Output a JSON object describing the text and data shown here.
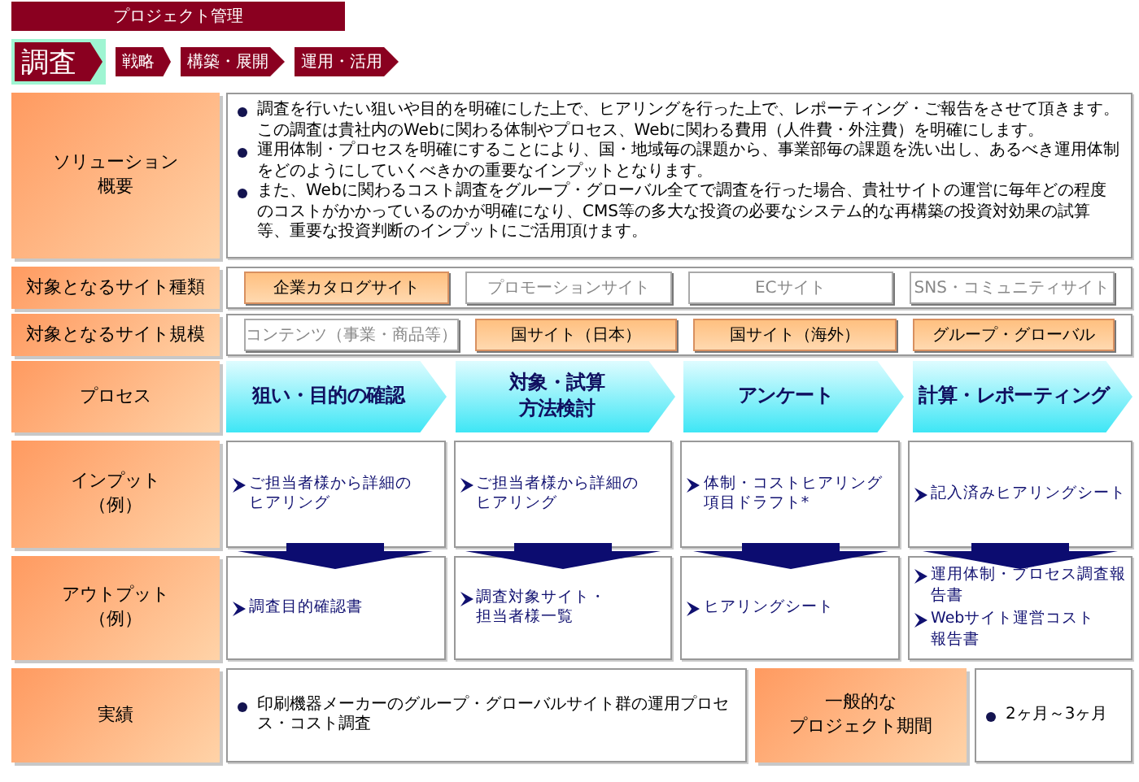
{
  "header": {
    "title": "プロジェクト管理"
  },
  "phases": [
    {
      "label": "調査",
      "selected": true
    },
    {
      "label": "戦略",
      "selected": false
    },
    {
      "label": "構築・展開",
      "selected": false
    },
    {
      "label": "運用・活用",
      "selected": false
    }
  ],
  "summary": {
    "label": [
      "ソリューション",
      "概要"
    ],
    "bullets": [
      "調査を行いたい狙いや目的を明確にした上で、ヒアリングを行った上で、レポーティング・ご報告をさせて頂きます。この調査は貴社内のWebに関わる体制やプロセス、Webに関わる費用（人件費・外注費）を明確にします。",
      "運用体制・プロセスを明確にすることにより、国・地域毎の課題から、事業部毎の課題を洗い出し、あるべき運用体制をどのようにしていくべきかの重要なインプットとなります。",
      "また、Webに関わるコスト調査をグループ・グローバル全てで調査を行った場合、貴社サイトの運営に毎年どの程度のコストがかかっているのかが明確になり、CMS等の多大な投資の必要なシステム的な再構築の投資対効果の試算等、重要な投資判断のインプットにご活用頂けます。"
    ]
  },
  "site_types": {
    "label": [
      "対象となるサイト種類"
    ],
    "options": [
      {
        "label": "企業カタログサイト",
        "selected": true
      },
      {
        "label": "プロモーションサイト",
        "selected": false
      },
      {
        "label": "ECサイト",
        "selected": false
      },
      {
        "label": "SNS・コミュニティサイト",
        "selected": false
      }
    ]
  },
  "site_scales": {
    "label": [
      "対象となるサイト規模"
    ],
    "options": [
      {
        "label": "コンテンツ（事業・商品等）",
        "selected": false
      },
      {
        "label": "国サイト（日本）",
        "selected": true
      },
      {
        "label": "国サイト（海外）",
        "selected": true
      },
      {
        "label": "グループ・グローバル",
        "selected": true
      }
    ]
  },
  "process": {
    "label": [
      "プロセス"
    ],
    "steps": [
      [
        "狙い・目的の確認"
      ],
      [
        "対象・試算",
        "方法検討"
      ],
      [
        "アンケート"
      ],
      [
        "計算・レポーティング"
      ]
    ]
  },
  "inputs": {
    "label": [
      "インプット",
      "（例）"
    ],
    "columns": [
      [
        [
          "ご担当者様から詳細の",
          "ヒアリング"
        ]
      ],
      [
        [
          "ご担当者様から詳細の",
          "ヒアリング"
        ]
      ],
      [
        [
          "体制・コストヒアリング",
          "項目ドラフト*"
        ]
      ],
      [
        [
          "記入済みヒアリングシート"
        ]
      ]
    ]
  },
  "outputs": {
    "label": [
      "アウトプット",
      "（例）"
    ],
    "columns": [
      [
        [
          "調査目的確認書"
        ]
      ],
      [
        [
          "調査対象サイト・",
          "担当者様一覧"
        ]
      ],
      [
        [
          "ヒアリングシート"
        ]
      ],
      [
        [
          "運用体制・プロセス調査報",
          "告書"
        ],
        [
          "Webサイト運営コスト",
          "報告書"
        ]
      ]
    ]
  },
  "results": {
    "label": [
      "実績"
    ],
    "bullets": [
      "印刷機器メーカーのグループ・グローバルサイト群の運用プロセス・コスト調査"
    ]
  },
  "duration": {
    "label": [
      "一般的な",
      "プロジェクト期間"
    ],
    "bullets": [
      "2ヶ月～3ヶ月"
    ]
  }
}
